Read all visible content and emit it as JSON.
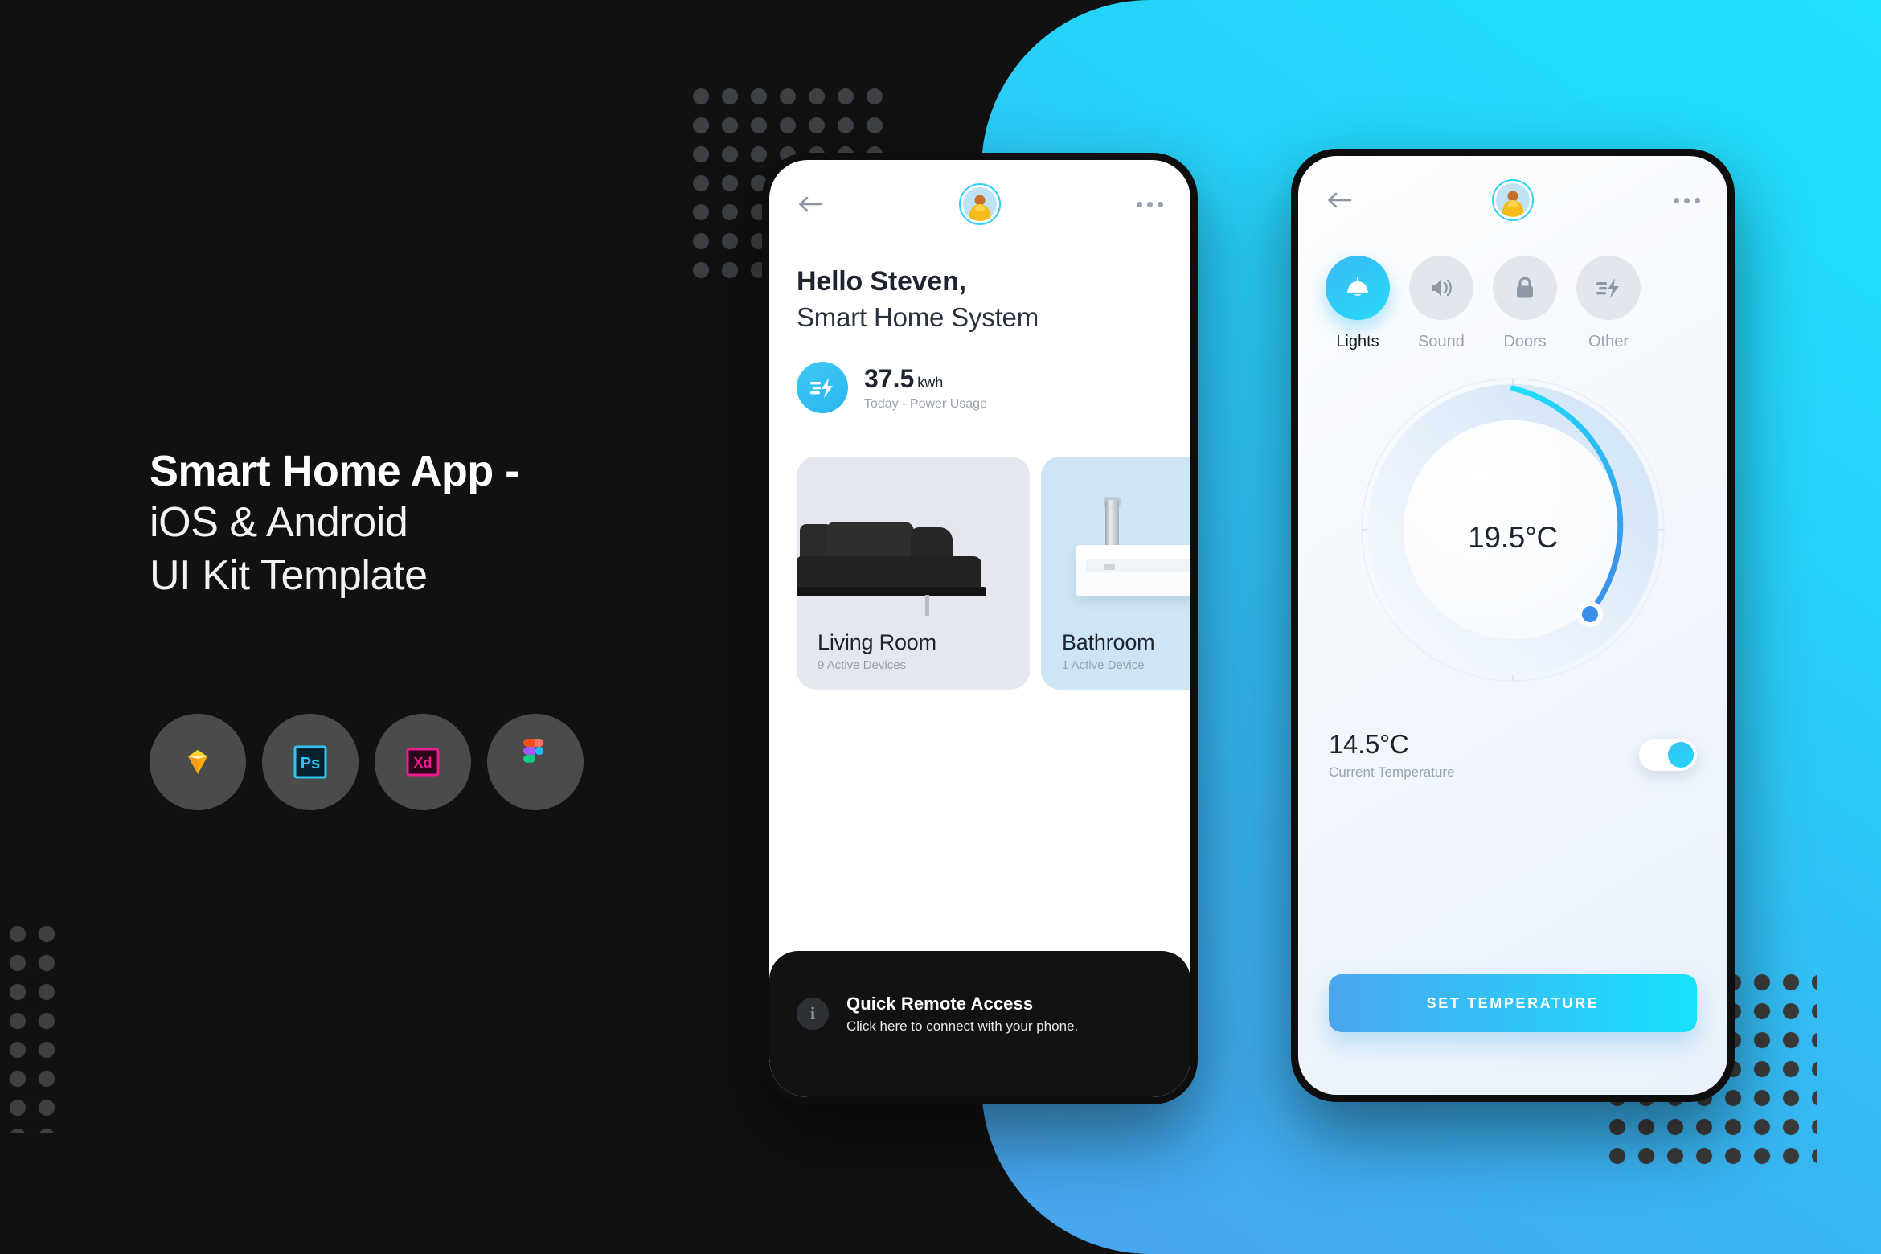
{
  "hero": {
    "title_line1": "Smart Home App -",
    "title_line2": "iOS & Android",
    "title_line3": "UI Kit Template",
    "tools": [
      {
        "name": "sketch-icon",
        "label": "Sketch"
      },
      {
        "name": "photoshop-icon",
        "label": "Ps"
      },
      {
        "name": "adobe-xd-icon",
        "label": "Xd"
      },
      {
        "name": "figma-icon",
        "label": "Figma"
      }
    ]
  },
  "colors": {
    "background": "#111111",
    "panel_gradient_from": "#4aa3ec",
    "panel_gradient_to": "#1fe0fb",
    "accent": "#2ed0f5",
    "accent_blue": "#3b8fe8",
    "dark_card": "#121212"
  },
  "phone1": {
    "topbar": {
      "back_icon": "back-arrow-icon",
      "avatar": "user-avatar",
      "menu_icon": "more-options-icon"
    },
    "greeting_name": "Hello Steven,",
    "greeting_sub": "Smart Home System",
    "power": {
      "icon": "power-bolt-icon",
      "value": "37.5",
      "unit": "kwh",
      "caption": "Today - Power Usage"
    },
    "rooms": [
      {
        "name": "Living Room",
        "devices": "9 Active Devices",
        "image": "sofa-photo"
      },
      {
        "name": "Bathroom",
        "devices": "1 Active Device",
        "image": "sink-photo"
      }
    ],
    "remote": {
      "icon": "info-icon",
      "title": "Quick Remote Access",
      "subtitle": "Click here to connect with your phone."
    }
  },
  "phone2": {
    "topbar": {
      "back_icon": "back-arrow-icon",
      "avatar": "user-avatar",
      "menu_icon": "more-options-icon"
    },
    "tabs": [
      {
        "label": "Lights",
        "icon": "pendant-lamp-icon",
        "active": true
      },
      {
        "label": "Sound",
        "icon": "speaker-icon",
        "active": false
      },
      {
        "label": "Doors",
        "icon": "lock-icon",
        "active": false
      },
      {
        "label": "Other",
        "icon": "bolt-icon",
        "active": false
      }
    ],
    "dial": {
      "target_temperature": "19.5°C",
      "arc_start_deg": 0,
      "arc_sweep_deg": 147,
      "knob": "dial-handle"
    },
    "current": {
      "value": "14.5°C",
      "label": "Current Temperature",
      "toggle_on": true
    },
    "set_button": "SET TEMPERATURE"
  }
}
